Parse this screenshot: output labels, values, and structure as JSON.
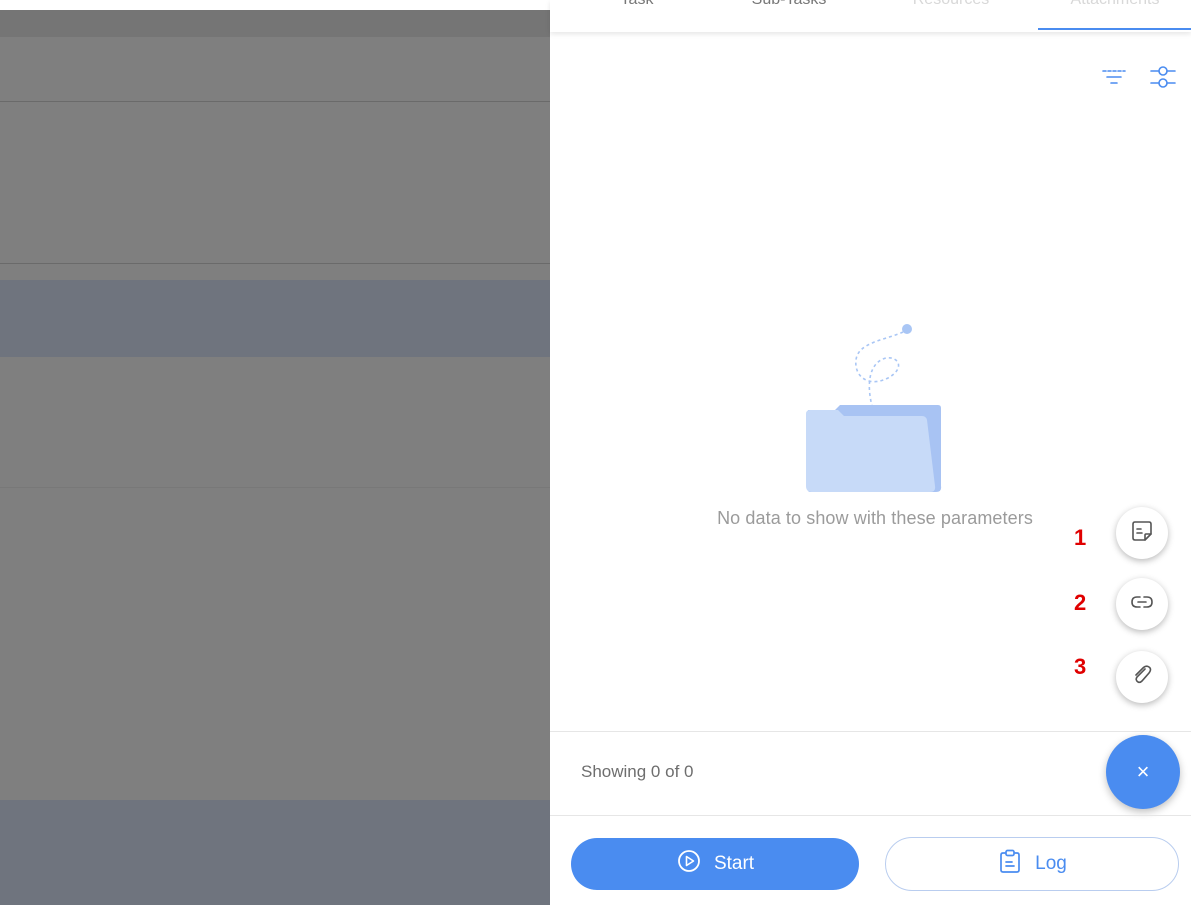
{
  "tabs": [
    {
      "label": "Task"
    },
    {
      "label": "Sub-Tasks"
    },
    {
      "label": "Resources"
    },
    {
      "label": "Attachments"
    }
  ],
  "active_tab": "Attachments",
  "toolbar": {
    "filter_icon": "filter-icon",
    "settings_icon": "sliders-icon"
  },
  "empty_state": {
    "icon": "empty-folder-illustration",
    "message": "No data to show with these parameters"
  },
  "speed_dial": {
    "items": [
      {
        "marker": "1",
        "icon": "note-icon"
      },
      {
        "marker": "2",
        "icon": "link-icon"
      },
      {
        "marker": "3",
        "icon": "paperclip-icon"
      }
    ],
    "close_icon": "close-icon",
    "close_glyph": "×"
  },
  "footer": {
    "showing": "Showing 0 of 0"
  },
  "actions": {
    "start_label": "Start",
    "start_icon": "play-circle-icon",
    "log_label": "Log",
    "log_icon": "clipboard-icon"
  },
  "colors": {
    "accent": "#4a8cf0",
    "marker": "#e00000",
    "overlay": "#7f7f7f"
  }
}
